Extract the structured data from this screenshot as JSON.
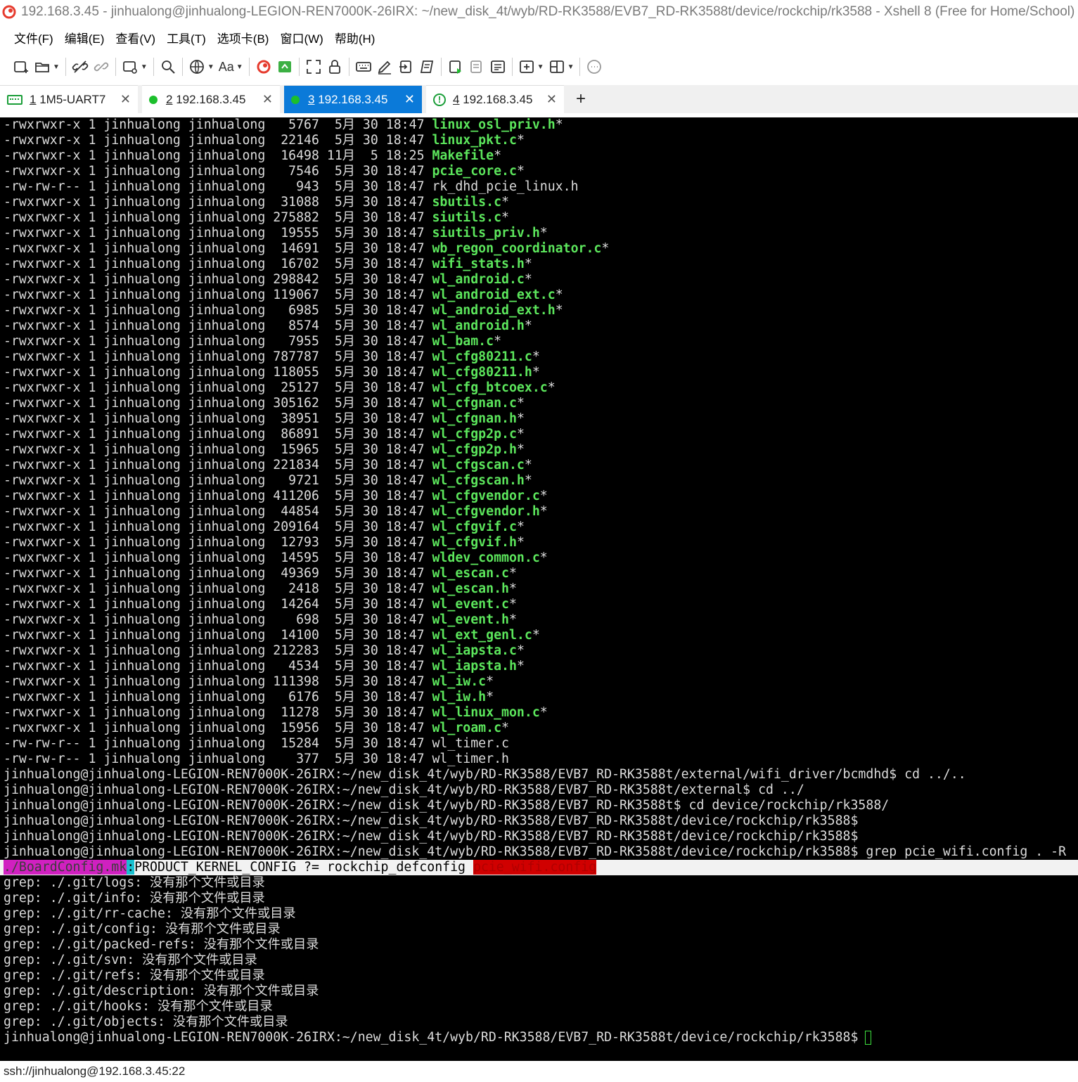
{
  "window": {
    "title": "192.168.3.45 - jinhualong@jinhualong-LEGION-REN7000K-26IRX: ~/new_disk_4t/wyb/RD-RK3588/EVB7_RD-RK3588t/device/rockchip/rk3588 - Xshell 8 (Free for Home/School)"
  },
  "menu": [
    "文件(F)",
    "编辑(E)",
    "查看(V)",
    "工具(T)",
    "选项卡(B)",
    "窗口(W)",
    "帮助(H)"
  ],
  "toolbar": {
    "font_button_label": "Aa"
  },
  "tabs": [
    {
      "index": "1",
      "label": "1M5-UART7",
      "status": "serial"
    },
    {
      "index": "2",
      "label": "192.168.3.45",
      "status": "connected"
    },
    {
      "index": "3",
      "label": "192.168.3.45",
      "status": "connected"
    },
    {
      "index": "4",
      "label": "192.168.3.45",
      "status": "warning"
    }
  ],
  "colors": {
    "accent": "#0b7ad9",
    "exe_green": "#5ce65c",
    "connected": "#1cbf2c",
    "terminal_bg": "#000000"
  },
  "terminal": {
    "listing": [
      {
        "meta": "-rwxrwxr-x 1 jinhualong jinhualong   5767  5月 30 18:47 ",
        "name": "linux_osl_priv.h",
        "suffix": "*"
      },
      {
        "meta": "-rwxrwxr-x 1 jinhualong jinhualong  22146  5月 30 18:47 ",
        "name": "linux_pkt.c",
        "suffix": "*"
      },
      {
        "meta": "-rwxrwxr-x 1 jinhualong jinhualong  16498 11月  5 18:25 ",
        "name": "Makefile",
        "suffix": "*"
      },
      {
        "meta": "-rwxrwxr-x 1 jinhualong jinhualong   7546  5月 30 18:47 ",
        "name": "pcie_core.c",
        "suffix": "*"
      },
      {
        "meta": "-rw-rw-r-- 1 jinhualong jinhualong    943  5月 30 18:47 ",
        "name": "rk_dhd_pcie_linux.h",
        "suffix": "",
        "plain": true
      },
      {
        "meta": "-rwxrwxr-x 1 jinhualong jinhualong  31088  5月 30 18:47 ",
        "name": "sbutils.c",
        "suffix": "*"
      },
      {
        "meta": "-rwxrwxr-x 1 jinhualong jinhualong 275882  5月 30 18:47 ",
        "name": "siutils.c",
        "suffix": "*"
      },
      {
        "meta": "-rwxrwxr-x 1 jinhualong jinhualong  19555  5月 30 18:47 ",
        "name": "siutils_priv.h",
        "suffix": "*"
      },
      {
        "meta": "-rwxrwxr-x 1 jinhualong jinhualong  14691  5月 30 18:47 ",
        "name": "wb_regon_coordinator.c",
        "suffix": "*"
      },
      {
        "meta": "-rwxrwxr-x 1 jinhualong jinhualong  16702  5月 30 18:47 ",
        "name": "wifi_stats.h",
        "suffix": "*"
      },
      {
        "meta": "-rwxrwxr-x 1 jinhualong jinhualong 298842  5月 30 18:47 ",
        "name": "wl_android.c",
        "suffix": "*"
      },
      {
        "meta": "-rwxrwxr-x 1 jinhualong jinhualong 119067  5月 30 18:47 ",
        "name": "wl_android_ext.c",
        "suffix": "*"
      },
      {
        "meta": "-rwxrwxr-x 1 jinhualong jinhualong   6985  5月 30 18:47 ",
        "name": "wl_android_ext.h",
        "suffix": "*"
      },
      {
        "meta": "-rwxrwxr-x 1 jinhualong jinhualong   8574  5月 30 18:47 ",
        "name": "wl_android.h",
        "suffix": "*"
      },
      {
        "meta": "-rwxrwxr-x 1 jinhualong jinhualong   7955  5月 30 18:47 ",
        "name": "wl_bam.c",
        "suffix": "*"
      },
      {
        "meta": "-rwxrwxr-x 1 jinhualong jinhualong 787787  5月 30 18:47 ",
        "name": "wl_cfg80211.c",
        "suffix": "*"
      },
      {
        "meta": "-rwxrwxr-x 1 jinhualong jinhualong 118055  5月 30 18:47 ",
        "name": "wl_cfg80211.h",
        "suffix": "*"
      },
      {
        "meta": "-rwxrwxr-x 1 jinhualong jinhualong  25127  5月 30 18:47 ",
        "name": "wl_cfg_btcoex.c",
        "suffix": "*"
      },
      {
        "meta": "-rwxrwxr-x 1 jinhualong jinhualong 305162  5月 30 18:47 ",
        "name": "wl_cfgnan.c",
        "suffix": "*"
      },
      {
        "meta": "-rwxrwxr-x 1 jinhualong jinhualong  38951  5月 30 18:47 ",
        "name": "wl_cfgnan.h",
        "suffix": "*"
      },
      {
        "meta": "-rwxrwxr-x 1 jinhualong jinhualong  86891  5月 30 18:47 ",
        "name": "wl_cfgp2p.c",
        "suffix": "*"
      },
      {
        "meta": "-rwxrwxr-x 1 jinhualong jinhualong  15965  5月 30 18:47 ",
        "name": "wl_cfgp2p.h",
        "suffix": "*"
      },
      {
        "meta": "-rwxrwxr-x 1 jinhualong jinhualong 221834  5月 30 18:47 ",
        "name": "wl_cfgscan.c",
        "suffix": "*"
      },
      {
        "meta": "-rwxrwxr-x 1 jinhualong jinhualong   9721  5月 30 18:47 ",
        "name": "wl_cfgscan.h",
        "suffix": "*"
      },
      {
        "meta": "-rwxrwxr-x 1 jinhualong jinhualong 411206  5月 30 18:47 ",
        "name": "wl_cfgvendor.c",
        "suffix": "*"
      },
      {
        "meta": "-rwxrwxr-x 1 jinhualong jinhualong  44854  5月 30 18:47 ",
        "name": "wl_cfgvendor.h",
        "suffix": "*"
      },
      {
        "meta": "-rwxrwxr-x 1 jinhualong jinhualong 209164  5月 30 18:47 ",
        "name": "wl_cfgvif.c",
        "suffix": "*"
      },
      {
        "meta": "-rwxrwxr-x 1 jinhualong jinhualong  12793  5月 30 18:47 ",
        "name": "wl_cfgvif.h",
        "suffix": "*"
      },
      {
        "meta": "-rwxrwxr-x 1 jinhualong jinhualong  14595  5月 30 18:47 ",
        "name": "wldev_common.c",
        "suffix": "*"
      },
      {
        "meta": "-rwxrwxr-x 1 jinhualong jinhualong  49369  5月 30 18:47 ",
        "name": "wl_escan.c",
        "suffix": "*"
      },
      {
        "meta": "-rwxrwxr-x 1 jinhualong jinhualong   2418  5月 30 18:47 ",
        "name": "wl_escan.h",
        "suffix": "*"
      },
      {
        "meta": "-rwxrwxr-x 1 jinhualong jinhualong  14264  5月 30 18:47 ",
        "name": "wl_event.c",
        "suffix": "*"
      },
      {
        "meta": "-rwxrwxr-x 1 jinhualong jinhualong    698  5月 30 18:47 ",
        "name": "wl_event.h",
        "suffix": "*"
      },
      {
        "meta": "-rwxrwxr-x 1 jinhualong jinhualong  14100  5月 30 18:47 ",
        "name": "wl_ext_genl.c",
        "suffix": "*"
      },
      {
        "meta": "-rwxrwxr-x 1 jinhualong jinhualong 212283  5月 30 18:47 ",
        "name": "wl_iapsta.c",
        "suffix": "*"
      },
      {
        "meta": "-rwxrwxr-x 1 jinhualong jinhualong   4534  5月 30 18:47 ",
        "name": "wl_iapsta.h",
        "suffix": "*"
      },
      {
        "meta": "-rwxrwxr-x 1 jinhualong jinhualong 111398  5月 30 18:47 ",
        "name": "wl_iw.c",
        "suffix": "*"
      },
      {
        "meta": "-rwxrwxr-x 1 jinhualong jinhualong   6176  5月 30 18:47 ",
        "name": "wl_iw.h",
        "suffix": "*"
      },
      {
        "meta": "-rwxrwxr-x 1 jinhualong jinhualong  11278  5月 30 18:47 ",
        "name": "wl_linux_mon.c",
        "suffix": "*"
      },
      {
        "meta": "-rwxrwxr-x 1 jinhualong jinhualong  15956  5月 30 18:47 ",
        "name": "wl_roam.c",
        "suffix": "*"
      },
      {
        "meta": "-rw-rw-r-- 1 jinhualong jinhualong  15284  5月 30 18:47 ",
        "name": "wl_timer.c",
        "suffix": "",
        "plain": true
      },
      {
        "meta": "-rw-rw-r-- 1 jinhualong jinhualong    377  5月 30 18:47 ",
        "name": "wl_timer.h",
        "suffix": "",
        "plain": true
      }
    ],
    "commands": [
      "jinhualong@jinhualong-LEGION-REN7000K-26IRX:~/new_disk_4t/wyb/RD-RK3588/EVB7_RD-RK3588t/external/wifi_driver/bcmdhd$ cd ../..",
      "jinhualong@jinhualong-LEGION-REN7000K-26IRX:~/new_disk_4t/wyb/RD-RK3588/EVB7_RD-RK3588t/external$ cd ../",
      "jinhualong@jinhualong-LEGION-REN7000K-26IRX:~/new_disk_4t/wyb/RD-RK3588/EVB7_RD-RK3588t$ cd device/rockchip/rk3588/",
      "jinhualong@jinhualong-LEGION-REN7000K-26IRX:~/new_disk_4t/wyb/RD-RK3588/EVB7_RD-RK3588t/device/rockchip/rk3588$",
      "jinhualong@jinhualong-LEGION-REN7000K-26IRX:~/new_disk_4t/wyb/RD-RK3588/EVB7_RD-RK3588t/device/rockchip/rk3588$",
      "jinhualong@jinhualong-LEGION-REN7000K-26IRX:~/new_disk_4t/wyb/RD-RK3588/EVB7_RD-RK3588t/device/rockchip/rk3588$ grep pcie_wifi.config . -R"
    ],
    "match": {
      "file": "./BoardConfig.mk",
      "sep": ":",
      "text": "PRODUCT_KERNEL_CONFIG ?= rockchip_defconfig ",
      "term": "pcie_wifi.config"
    },
    "errors": [
      "grep: ./.git/logs: 没有那个文件或目录",
      "grep: ./.git/info: 没有那个文件或目录",
      "grep: ./.git/rr-cache: 没有那个文件或目录",
      "grep: ./.git/config: 没有那个文件或目录",
      "grep: ./.git/packed-refs: 没有那个文件或目录",
      "grep: ./.git/svn: 没有那个文件或目录",
      "grep: ./.git/refs: 没有那个文件或目录",
      "grep: ./.git/description: 没有那个文件或目录",
      "grep: ./.git/hooks: 没有那个文件或目录",
      "grep: ./.git/objects: 没有那个文件或目录"
    ],
    "final_prompt": "jinhualong@jinhualong-LEGION-REN7000K-26IRX:~/new_disk_4t/wyb/RD-RK3588/EVB7_RD-RK3588t/device/rockchip/rk3588$"
  },
  "status_bar": {
    "text": "ssh://jinhualong@192.168.3.45:22"
  }
}
